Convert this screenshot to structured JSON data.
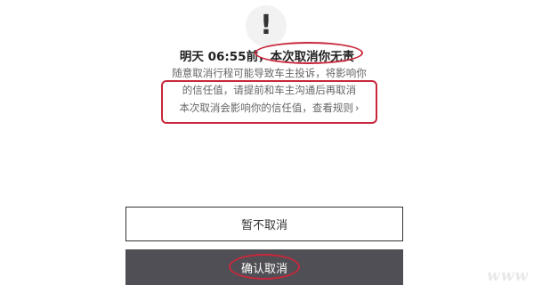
{
  "dialog": {
    "icon": "exclamation-icon",
    "icon_glyph": "!",
    "title_prefix": "明天 06:55前，",
    "title_highlight": "本次取消你无责",
    "desc_line1": "随意取消行程可能导致车主投诉，将影响你",
    "desc_line2": "的信任值，请提前和车主沟通后再取消",
    "desc_line3": "本次取消会影响你的信任值，查看规则",
    "desc_chevron": "›"
  },
  "buttons": {
    "keep_label": "暂不取消",
    "confirm_label": "确认取消"
  },
  "annotations": {
    "color": "#c8283c"
  },
  "watermark": "www"
}
